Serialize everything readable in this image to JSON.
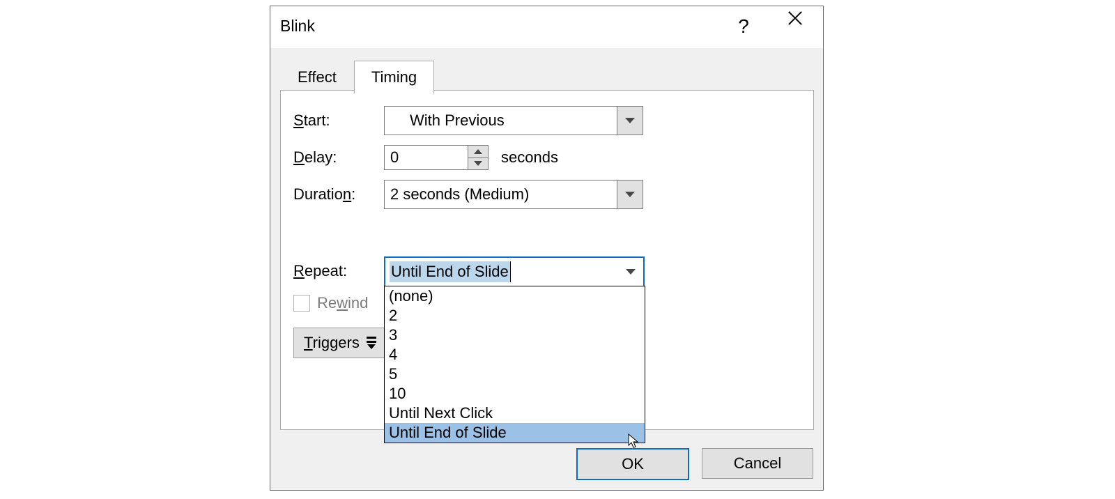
{
  "dialog": {
    "title": "Blink",
    "help": "?",
    "tabs": {
      "effect": "Effect",
      "timing": "Timing"
    },
    "timing": {
      "start_label_pre": "S",
      "start_label_post": "tart:",
      "start_value": "With Previous",
      "delay_label_pre": "D",
      "delay_label_post": "elay:",
      "delay_value": "0",
      "delay_unit": "seconds",
      "duration_label_pre": "Duratio",
      "duration_label_u": "n",
      "duration_label_post": ":",
      "duration_value": "2 seconds (Medium)",
      "repeat_label_pre": "R",
      "repeat_label_post": "epeat:",
      "repeat_value": "Until End of Slide",
      "repeat_options": {
        "o0": "(none)",
        "o1": "2",
        "o2": "3",
        "o3": "4",
        "o4": "5",
        "o5": "10",
        "o6": "Until Next Click",
        "o7": "Until End of Slide"
      },
      "rewind_label_pre": "Re",
      "rewind_label_u": "w",
      "rewind_label_post": "ind",
      "triggers_label_pre": "T",
      "triggers_label_post": "riggers"
    },
    "footer": {
      "ok": "OK",
      "cancel": "Cancel"
    }
  }
}
